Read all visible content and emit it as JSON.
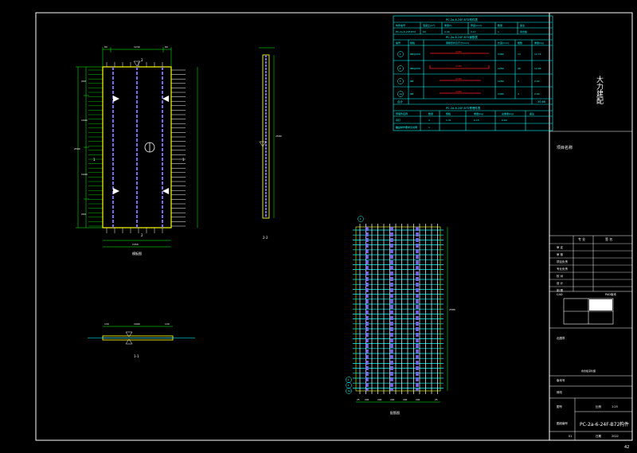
{
  "app": {
    "page_number": "42"
  },
  "title_block": {
    "company": "大力建配",
    "project_label": "项目名称",
    "drawing_title_note": "叠合板深化图",
    "rows": [
      "审 定",
      "审 核",
      "项目负责",
      "专业负责",
      "校 对",
      "设 计",
      "制 图"
    ],
    "col_a": "专 业",
    "col_b": "签 名",
    "cad_label": "CAD",
    "pad_label": "PAD版本",
    "drawing_no_label": "图纸编号",
    "drawing_no": "PC-2a-6-24F-B72",
    "drawing_no_suffix": "构件",
    "scale_label": "比例",
    "scale_value": "1:25",
    "date_label": "日期",
    "date_value": "2022",
    "sheet_label": "图号",
    "sheet_value": "01",
    "version_label": "版本号",
    "revision_label": "修改",
    "stamp_label": "出图章"
  },
  "tables": {
    "t1_title": "PC-2a-6-24F-B72构件表",
    "t1_headers": [
      "构件编号",
      "混凝土(m³)",
      "重量(t)",
      "厚度(mm)",
      "数量",
      "备注"
    ],
    "t1_row": [
      "PC-2a-6-24F-B72",
      "60",
      "0.40",
      "0.17",
      "1",
      "叠合板"
    ],
    "t2_title": "PC-2a-6-24F-B72钢筋表",
    "t2_headers": [
      "编号",
      "规格",
      "钢筋形状及尺寸(mm)",
      "长度(mm)",
      "根数",
      "重量(kg)"
    ],
    "t2_rows": [
      [
        "1",
        "Φ8@200",
        "2380",
        "2480",
        "13",
        "12.74"
      ],
      [
        "2",
        "Φ8@200",
        "1160",
        "1260",
        "26",
        "12.96"
      ],
      [
        "3",
        "Φ8",
        "1180",
        "1280",
        "4",
        "2.02"
      ],
      [
        "1a",
        "Φ8",
        "2380",
        "2480",
        "3",
        "2.94"
      ]
    ],
    "t2_total_label": "合计",
    "t2_total": "30.66",
    "t3_title": "PC-2a-6-24F-B72预埋件表",
    "t3_headers": [
      "预埋件名称",
      "数量",
      "规格",
      "重量(kg)",
      "总重量(kg)",
      "备注"
    ],
    "t3_rows": [
      [
        "吊钉",
        "4",
        "1.3t",
        "0.15",
        "0.60",
        ""
      ],
      [
        "线盒",
        "1",
        "",
        "",
        "",
        ""
      ]
    ]
  },
  "plan": {
    "caption": "模板图",
    "top_dims": [
      "60",
      "1230",
      "60"
    ],
    "width_dim": "1350",
    "height_dim": "2580",
    "height_parts": [
      "200",
      "1090",
      "1090",
      "200"
    ],
    "section_marks": [
      "1",
      "1",
      "2",
      "2"
    ]
  },
  "section_2": {
    "caption": "2-2",
    "height_dim": "2580"
  },
  "section_1": {
    "caption": "1-1",
    "dims": [
      "130",
      "1090",
      "130"
    ]
  },
  "rebar": {
    "caption": "配筋图",
    "markers": [
      "1",
      "2",
      "3",
      "1a"
    ],
    "bottom_dims": [
      "25",
      "200",
      "200",
      "200",
      "200",
      "200",
      "25"
    ],
    "side_dim": "2580"
  },
  "colors": {
    "background": "#000000",
    "line": "#ffffff",
    "outline": "#ffff00",
    "dimension": "#00ff00",
    "rebar": "#00ffff",
    "lattice": "#7b68ee",
    "table": "#00ffff",
    "highlight": "#ff2020"
  },
  "icons": [
    "lifting-point-triangle-icon",
    "north-arrow-icon",
    "rebar-marker-circle-icon"
  ]
}
